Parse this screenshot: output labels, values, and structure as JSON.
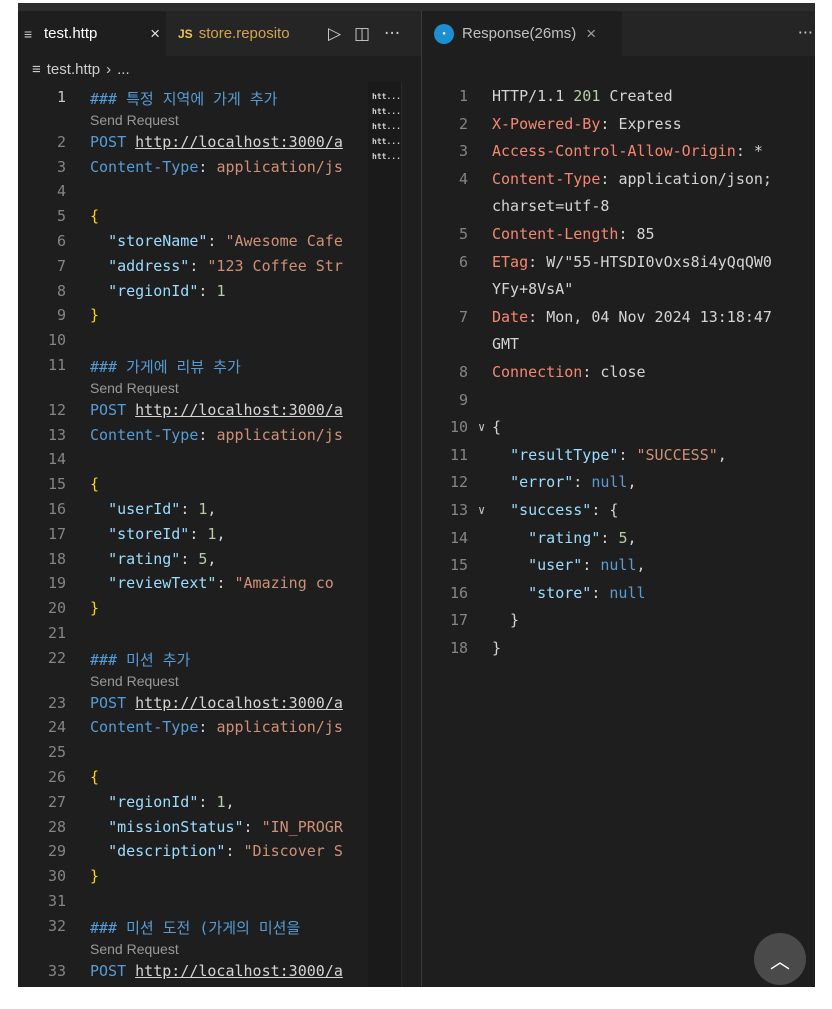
{
  "editor": {
    "tabs": [
      {
        "label": "test.http",
        "close": "×"
      },
      {
        "label": "store.reposito",
        "badge": "JS"
      }
    ],
    "actions": {
      "run": "▷",
      "split": "◫",
      "more": "···"
    },
    "breadcrumb": {
      "file": "test.http",
      "sep": "›",
      "rest": "..."
    },
    "minimap_lines": [
      "htt...",
      "htt...",
      "htt...",
      "htt...",
      "htt..."
    ]
  },
  "code_lines": [
    {
      "n": "1",
      "t": "### 특정 지역에 가게 추가"
    },
    {
      "n": "",
      "lens": "Send Request"
    },
    {
      "n": "2",
      "t": "POST http://localhost:3000/a"
    },
    {
      "n": "3",
      "t": "Content-Type: application/js"
    },
    {
      "n": "4",
      "t": ""
    },
    {
      "n": "5",
      "t": "{"
    },
    {
      "n": "6",
      "t": "  \"storeName\": \"Awesome Cafe"
    },
    {
      "n": "7",
      "t": "  \"address\": \"123 Coffee Str"
    },
    {
      "n": "8",
      "t": "  \"regionId\": 1"
    },
    {
      "n": "9",
      "t": "}"
    },
    {
      "n": "10",
      "t": ""
    },
    {
      "n": "11",
      "t": "### 가게에 리뷰 추가"
    },
    {
      "n": "",
      "lens": "Send Request"
    },
    {
      "n": "12",
      "t": "POST http://localhost:3000/a"
    },
    {
      "n": "13",
      "t": "Content-Type: application/js"
    },
    {
      "n": "14",
      "t": ""
    },
    {
      "n": "15",
      "t": "{"
    },
    {
      "n": "16",
      "t": "  \"userId\": 1,"
    },
    {
      "n": "17",
      "t": "  \"storeId\": 1,"
    },
    {
      "n": "18",
      "t": "  \"rating\": 5,"
    },
    {
      "n": "19",
      "t": "  \"reviewText\": \"Amazing co"
    },
    {
      "n": "20",
      "t": "}"
    },
    {
      "n": "21",
      "t": ""
    },
    {
      "n": "22",
      "t": "### 미션 추가"
    },
    {
      "n": "",
      "lens": "Send Request"
    },
    {
      "n": "23",
      "t": "POST http://localhost:3000/a"
    },
    {
      "n": "24",
      "t": "Content-Type: application/js"
    },
    {
      "n": "25",
      "t": ""
    },
    {
      "n": "26",
      "t": "{"
    },
    {
      "n": "27",
      "t": "  \"regionId\": 1,"
    },
    {
      "n": "28",
      "t": "  \"missionStatus\": \"IN_PROGR"
    },
    {
      "n": "29",
      "t": "  \"description\": \"Discover S"
    },
    {
      "n": "30",
      "t": "}"
    },
    {
      "n": "31",
      "t": ""
    },
    {
      "n": "32",
      "t": "### 미션 도전 (가게의 미션을"
    },
    {
      "n": "",
      "lens": "Send Request"
    },
    {
      "n": "33",
      "t": "POST http://localhost:3000/a"
    }
  ],
  "response": {
    "tab_label": "Response(26ms)",
    "close": "×",
    "more": "···",
    "lines": [
      {
        "n": "1",
        "t": "HTTP/1.1 201 Created"
      },
      {
        "n": "2",
        "t": "X-Powered-By: Express"
      },
      {
        "n": "3",
        "t": "Access-Control-Allow-Origin: *"
      },
      {
        "n": "4",
        "t": "Content-Type: application/json;"
      },
      {
        "n": "",
        "t": "charset=utf-8"
      },
      {
        "n": "5",
        "t": "Content-Length: 85"
      },
      {
        "n": "6",
        "t": "ETag: W/\"55-HTSDI0vOxs8i4yQqQW0"
      },
      {
        "n": "",
        "t": "YFy+8VsA\""
      },
      {
        "n": "7",
        "t": "Date: Mon, 04 Nov 2024 13:18:47"
      },
      {
        "n": "",
        "t": "GMT"
      },
      {
        "n": "8",
        "t": "Connection: close"
      },
      {
        "n": "9",
        "t": ""
      },
      {
        "n": "10",
        "t": "{"
      },
      {
        "n": "11",
        "t": "  \"resultType\": \"SUCCESS\","
      },
      {
        "n": "12",
        "t": "  \"error\": null,"
      },
      {
        "n": "13",
        "t": "  \"success\": {"
      },
      {
        "n": "14",
        "t": "    \"rating\": 5,"
      },
      {
        "n": "15",
        "t": "    \"user\": null,"
      },
      {
        "n": "16",
        "t": "    \"store\": null"
      },
      {
        "n": "17",
        "t": "  }"
      },
      {
        "n": "18",
        "t": "}"
      }
    ]
  },
  "scroll_top_glyph": "︿"
}
